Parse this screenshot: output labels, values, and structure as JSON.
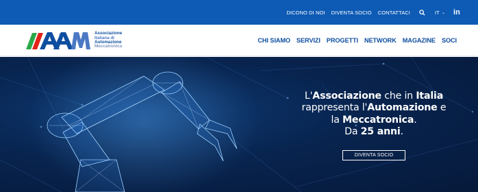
{
  "topbar": {
    "links": [
      "DICONO DI NOI",
      "DIVENTA SOCIO",
      "CONTATTACI"
    ],
    "language": "IT",
    "social": "in"
  },
  "logo": {
    "lines": [
      "Associazione",
      "Italiana di",
      "Automazione",
      "Meccatronica"
    ]
  },
  "nav": {
    "items": [
      "CHI SIAMO",
      "SERVIZI",
      "PROGETTI",
      "NETWORK",
      "MAGAZINE",
      "SOCI"
    ]
  },
  "hero": {
    "line1_pre": "L'",
    "line1_b1": "Associazione",
    "line1_mid": " che in ",
    "line1_b2": "Italia",
    "line2_pre": "rappresenta l'",
    "line2_b": "Automazione",
    "line2_post": " e",
    "line3_pre": "la ",
    "line3_b": "Meccatronica",
    "line3_post": ".",
    "line4_pre": "Da ",
    "line4_b": "25 anni",
    "line4_post": ".",
    "button": "DIVENTA SOCIO"
  },
  "colors": {
    "brand_blue": "#0e5bb5",
    "nav_blue": "#0e4ea0",
    "logo_green": "#2aa84a",
    "logo_red": "#e2231a",
    "hero_dark": "#06193a"
  },
  "icons": [
    "search-icon",
    "chevron-down-icon",
    "linkedin-icon"
  ]
}
